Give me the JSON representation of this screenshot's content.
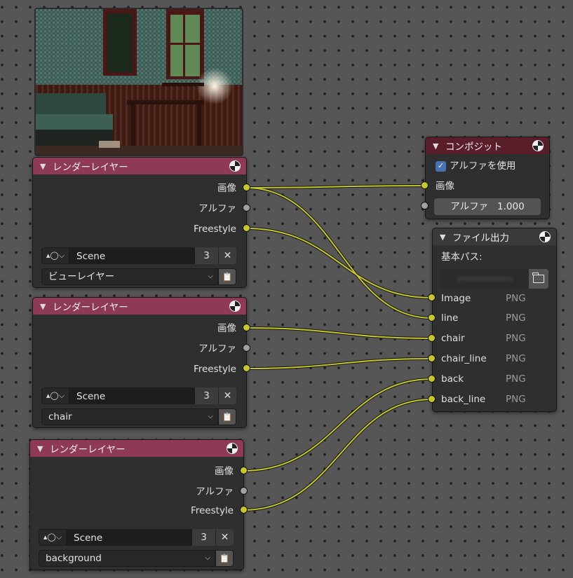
{
  "render_nodes": [
    {
      "title": "レンダーレイヤー",
      "outputs": [
        "画像",
        "アルファ",
        "Freestyle"
      ],
      "scene": "Scene",
      "scene_users": "3",
      "layer": "ビューレイヤー"
    },
    {
      "title": "レンダーレイヤー",
      "outputs": [
        "画像",
        "アルファ",
        "Freestyle"
      ],
      "scene": "Scene",
      "scene_users": "3",
      "layer": "chair"
    },
    {
      "title": "レンダーレイヤー",
      "outputs": [
        "画像",
        "アルファ",
        "Freestyle"
      ],
      "scene": "Scene",
      "scene_users": "3",
      "layer": "background"
    }
  ],
  "composite": {
    "title": "コンポジット",
    "use_alpha_label": "アルファを使用",
    "use_alpha": true,
    "image_input": "画像",
    "alpha_label": "アルファ",
    "alpha_value": "1.000"
  },
  "file_output": {
    "title": "ファイル出力",
    "base_path_label": "基本パス:",
    "inputs": [
      {
        "name": "Image",
        "format": "PNG"
      },
      {
        "name": "line",
        "format": "PNG"
      },
      {
        "name": "chair",
        "format": "PNG"
      },
      {
        "name": "chair_line",
        "format": "PNG"
      },
      {
        "name": "back",
        "format": "PNG"
      },
      {
        "name": "back_line",
        "format": "PNG"
      }
    ]
  },
  "icons": {
    "collapse": "chevron-down-icon",
    "node_preview": "render-result-icon",
    "scene_browse": "scene-data-icon",
    "unlink": "close-icon",
    "layer_browse": "clipboard-icon",
    "folder": "folder-icon"
  },
  "colors": {
    "link": "#c7c729",
    "render_header": "#8e3a55",
    "composite_header": "#5a1e2b",
    "checkbox": "#4772b3"
  }
}
